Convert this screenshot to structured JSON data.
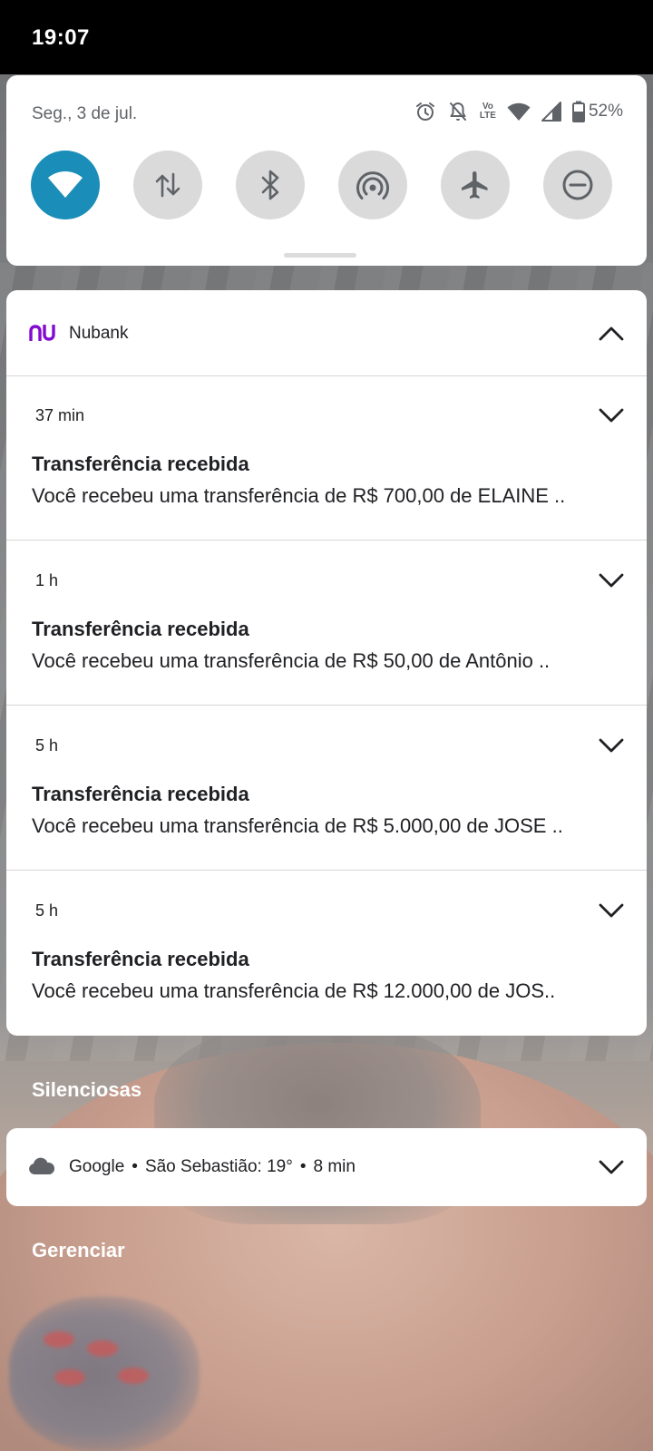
{
  "status_bar": {
    "time": "19:07"
  },
  "quick_settings": {
    "date": "Seg., 3 de jul.",
    "volte_label": "Vo\nLTE",
    "battery": "52%",
    "tiles": [
      {
        "name": "wifi",
        "icon": "wifi-icon",
        "active": true
      },
      {
        "name": "mobile-data",
        "icon": "data-arrows-icon",
        "active": false
      },
      {
        "name": "bluetooth",
        "icon": "bluetooth-icon",
        "active": false
      },
      {
        "name": "hotspot",
        "icon": "hotspot-icon",
        "active": false
      },
      {
        "name": "airplane-mode",
        "icon": "airplane-icon",
        "active": false
      },
      {
        "name": "do-not-disturb",
        "icon": "dnd-icon",
        "active": false
      }
    ],
    "accent_color": "#1a8eb8"
  },
  "nubank_group": {
    "app_name": "Nubank",
    "brand_color": "#820ad1",
    "notifications": [
      {
        "time": "37 min",
        "title": "Transferência recebida",
        "text": "Você recebeu uma transferência de R$ 700,00 de ELAINE .."
      },
      {
        "time": "1 h",
        "title": "Transferência recebida",
        "text": "Você recebeu uma transferência de R$ 50,00 de Antônio .."
      },
      {
        "time": "5 h",
        "title": "Transferência recebida",
        "text": "Você recebeu uma transferência de R$ 5.000,00 de JOSE .."
      },
      {
        "time": "5 h",
        "title": "Transferência recebida",
        "text": "Você recebeu uma transferência de R$ 12.000,00 de JOS.."
      }
    ]
  },
  "silent_section": {
    "label": "Silenciosas",
    "google": {
      "app": "Google",
      "weather": "São Sebastião: 19°",
      "time": "8 min",
      "separator": "•"
    }
  },
  "manage_label": "Gerenciar"
}
